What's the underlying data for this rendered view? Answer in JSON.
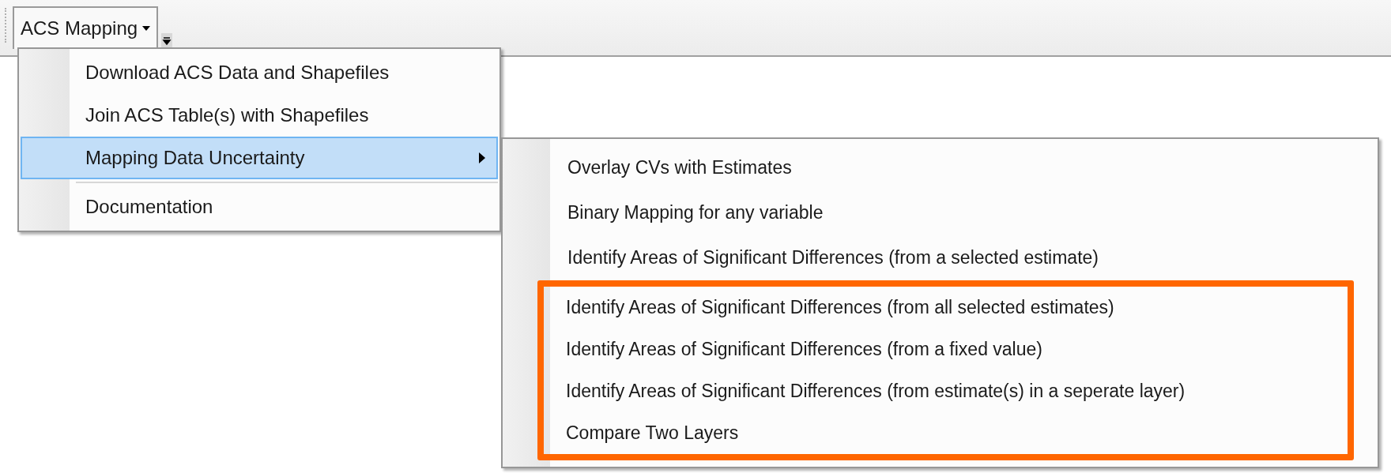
{
  "toolbar": {
    "menu_button": {
      "label": "ACS Mapping",
      "open": true
    }
  },
  "menu": {
    "items": [
      {
        "kind": "item",
        "label": "Download ACS Data and Shapefiles",
        "selected": false,
        "has_submenu": false
      },
      {
        "kind": "item",
        "label": "Join ACS Table(s) with Shapefiles",
        "selected": false,
        "has_submenu": false
      },
      {
        "kind": "item",
        "label": "Mapping Data Uncertainty",
        "selected": true,
        "has_submenu": true
      },
      {
        "kind": "separator"
      },
      {
        "kind": "item",
        "label": "Documentation",
        "selected": false,
        "has_submenu": false
      }
    ]
  },
  "submenu": {
    "items": [
      {
        "label": "Overlay CVs with Estimates",
        "highlighted": false
      },
      {
        "label": "Binary Mapping for any variable",
        "highlighted": false
      },
      {
        "label": "Identify Areas of Significant Differences (from a selected estimate)",
        "highlighted": false
      },
      {
        "label": "Identify Areas of Significant Differences (from all selected estimates)",
        "highlighted": true
      },
      {
        "label": "Identify Areas of Significant Differences (from a fixed value)",
        "highlighted": true
      },
      {
        "label": "Identify Areas of Significant Differences (from estimate(s) in a seperate layer)",
        "highlighted": true
      },
      {
        "label": "Compare Two Layers",
        "highlighted": true
      }
    ]
  }
}
